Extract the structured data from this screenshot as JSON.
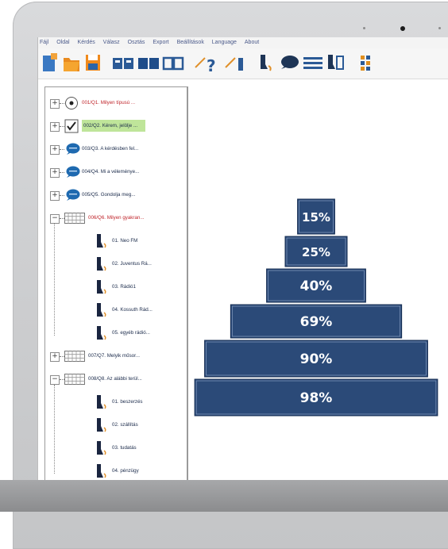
{
  "menu": [
    "Fájl",
    "Oldal",
    "Kérdés",
    "Válasz",
    "Osztás",
    "Export",
    "Beállítások",
    "Language",
    "About"
  ],
  "toolbar_icons": [
    "new-document-icon",
    "open-folder-icon",
    "save-icon",
    "book-open-icon",
    "book-icon",
    "two-columns-icon",
    "question-arrow-icon",
    "pencil-arrow-icon",
    "person-speaking-icon",
    "speech-bubble-icon",
    "lines-icon",
    "person-list-icon",
    "grid-icon"
  ],
  "tree": {
    "rows": [
      {
        "expander": "+",
        "icon": "radio-icon",
        "text": "001/Q1. Milyen típusú ...",
        "color": "red"
      },
      {
        "expander": "+",
        "icon": "checkbox-icon",
        "text": "002/Q2. Kérem, jelölje ...",
        "color": "normal",
        "highlight": true
      },
      {
        "expander": "+",
        "icon": "speech-bubble-icon",
        "text": "003/Q3. A kérdésben fel...",
        "color": "normal"
      },
      {
        "expander": "+",
        "icon": "speech-bubble-icon",
        "text": "004/Q4. Mi a véleménye...",
        "color": "normal"
      },
      {
        "expander": "+",
        "icon": "speech-bubble-icon",
        "text": "005/Q5. Gondolja meg...",
        "color": "normal"
      },
      {
        "expander": "−",
        "icon": "grid-icon",
        "text": "006/Q6. Milyen gyakran...",
        "color": "red"
      },
      {
        "expander": "",
        "icon": "person-speaking-icon",
        "text": "01. Neo FM",
        "color": "normal",
        "child": true
      },
      {
        "expander": "",
        "icon": "person-speaking-icon",
        "text": "02. Juventus Rá...",
        "color": "normal",
        "child": true
      },
      {
        "expander": "",
        "icon": "person-speaking-icon",
        "text": "03. Rádió1",
        "color": "normal",
        "child": true
      },
      {
        "expander": "",
        "icon": "person-speaking-icon",
        "text": "04. Kossuth Rád...",
        "color": "normal",
        "child": true
      },
      {
        "expander": "",
        "icon": "person-speaking-icon",
        "text": "05. egyéb rádió...",
        "color": "normal",
        "child": true
      },
      {
        "expander": "+",
        "icon": "grid-icon",
        "text": "007/Q7. Melyik műsor...",
        "color": "normal"
      },
      {
        "expander": "−",
        "icon": "grid-icon",
        "text": "008/Q8. Az alábbi terül...",
        "color": "normal"
      },
      {
        "expander": "",
        "icon": "person-speaking-icon",
        "text": "01. beszerzés",
        "color": "normal",
        "child": true
      },
      {
        "expander": "",
        "icon": "person-speaking-icon",
        "text": "02. szállítás",
        "color": "normal",
        "child": true
      },
      {
        "expander": "",
        "icon": "person-speaking-icon",
        "text": "03. tudatás",
        "color": "normal",
        "child": true
      },
      {
        "expander": "",
        "icon": "person-speaking-icon",
        "text": "04. pénzügy",
        "color": "normal",
        "child": true
      }
    ]
  },
  "pyramid": {
    "levels": [
      {
        "label": "15%",
        "value": 15
      },
      {
        "label": "25%",
        "value": 25
      },
      {
        "label": "40%",
        "value": 40
      },
      {
        "label": "69%",
        "value": 69
      },
      {
        "label": "90%",
        "value": 90
      },
      {
        "label": "98%",
        "value": 98
      }
    ]
  },
  "colors": {
    "bar": "#2b4a78",
    "tree_red": "#c0272d",
    "highlight": "#bfe59a"
  }
}
